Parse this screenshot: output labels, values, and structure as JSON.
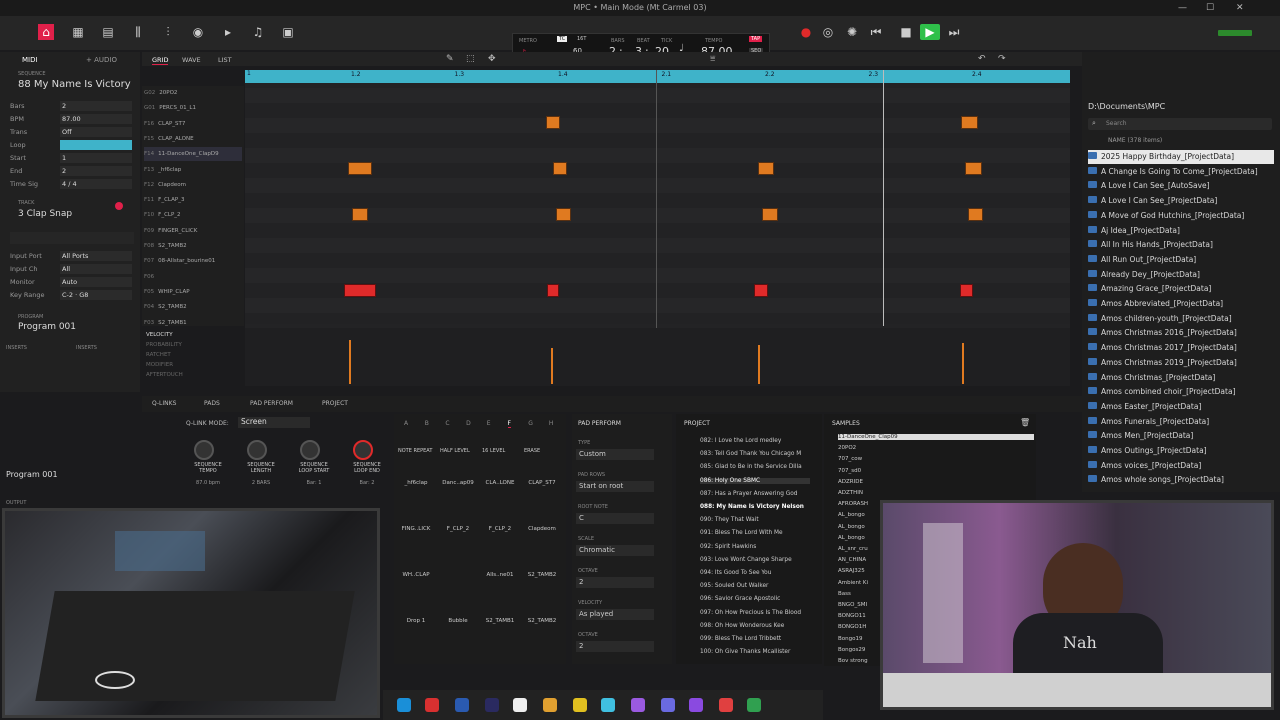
{
  "window_title": "MPC • Main Mode (Mt Carmel 03)",
  "toolbar": {
    "tempo": "87.00",
    "bar": "2",
    "beat": "3",
    "tick": "20",
    "bars_label": "BARS",
    "beat_label": "BEAT",
    "tick_label": "TICK",
    "tempo_label": "TEMPO",
    "tap_label": "TAP",
    "seq_label": "SEQ",
    "metro_label": "METRO",
    "tc_label": "TC",
    "sixteenth": "16T",
    "count": "60",
    "bpm_small": "BPM",
    "tc": "TC",
    "accent": "#e0204a"
  },
  "left": {
    "tab_midi": "MIDI",
    "tab_audio": "+ AUDIO",
    "sequence_label": "SEQUENCE",
    "sequence_name": "88 My Name Is Victory",
    "rows": [
      {
        "k": "Bars",
        "v": "2"
      },
      {
        "k": "BPM",
        "v": "87.00"
      },
      {
        "k": "Trans",
        "v": "Off"
      },
      {
        "k": "Loop",
        "v": ""
      },
      {
        "k": "Start",
        "v": "1"
      },
      {
        "k": "End",
        "v": "2"
      },
      {
        "k": "Time Sig",
        "v": "4   /   4"
      }
    ],
    "track_label": "TRACK",
    "track_name": "3 Clap Snap",
    "track_rows": [
      {
        "k": "Input Port",
        "v": "All Ports"
      },
      {
        "k": "Input Ch",
        "v": "All"
      },
      {
        "k": "Monitor",
        "v": "Auto"
      },
      {
        "k": "Key Range",
        "v": "C-2 · G8"
      }
    ],
    "program_label": "PROGRAM",
    "program_name": "Program 001",
    "inserts_1": "INSERTS",
    "inserts_2": "INSERTS",
    "program_bottom": "Program 001",
    "output": "OUTPUT"
  },
  "grid_tabs": {
    "grid": "GRID",
    "wave": "WAVE",
    "list": "LIST"
  },
  "ruler": [
    "1.2",
    "1.3",
    "1.4",
    "2.1",
    "2.2",
    "2.3",
    "2.4"
  ],
  "ruler_start": "1",
  "tracks": [
    {
      "p": "G02",
      "n": "20PO2"
    },
    {
      "p": "G01",
      "n": "PERCS_01_L1"
    },
    {
      "p": "F16",
      "n": "CLAP_ST7"
    },
    {
      "p": "F15",
      "n": "CLAP_ALONE"
    },
    {
      "p": "F14",
      "n": "11-DanceOne_ClapD9"
    },
    {
      "p": "F13",
      "n": "_hf6clap"
    },
    {
      "p": "F12",
      "n": "Clapdeom"
    },
    {
      "p": "F11",
      "n": "F_CLAP_3"
    },
    {
      "p": "F10",
      "n": "F_CLP_2"
    },
    {
      "p": "F09",
      "n": "FINGER_CLICK"
    },
    {
      "p": "F08",
      "n": "S2_TAMB2"
    },
    {
      "p": "F07",
      "n": "08-Allstar_bourine01"
    },
    {
      "p": "F06",
      "n": ""
    },
    {
      "p": "F05",
      "n": "WHIP_CLAP"
    },
    {
      "p": "F04",
      "n": "S2_TAMB2"
    },
    {
      "p": "F03",
      "n": "S2_TAMB1"
    }
  ],
  "lanes": [
    "VELOCITY",
    "PROBABILITY",
    "RATCHET",
    "MODIFIER",
    "AFTERTOUCH"
  ],
  "bottom_tabs": {
    "qlinks": "Q-LINKS",
    "pads": "PADS",
    "pad_perform": "PAD PERFORM",
    "project": "PROJECT"
  },
  "qlink": {
    "mode_label": "Q-LINK MODE:",
    "mode": "Screen",
    "knobs": [
      {
        "l": "SEQUENCE TEMPO",
        "v": "87.0 bpm"
      },
      {
        "l": "SEQUENCE LENGTH",
        "v": "2 BARS"
      },
      {
        "l": "SEQUENCE LOOP START",
        "v": "Bar: 1"
      },
      {
        "l": "SEQUENCE LOOP END",
        "v": "Bar: 2"
      }
    ]
  },
  "pad_banks": [
    "A",
    "B",
    "C",
    "D",
    "E",
    "F",
    "G",
    "H"
  ],
  "pad_modes": [
    "NOTE REPEAT",
    "HALF LEVEL",
    "16 LEVEL",
    "ERASE"
  ],
  "pads": [
    "_hf6clap",
    "Danc..ap09",
    "CLA..LONE",
    "CLAP_ST7",
    "FING..LICK",
    "F_CLP_2",
    "F_CLP_2",
    "Clapdeom",
    "WH..CLAP",
    "",
    "Alls..ne01",
    "S2_TAMB2",
    "Drop 1",
    "Bubble",
    "S2_TAMB1",
    "S2_TAMB2"
  ],
  "perform": {
    "title": "PAD PERFORM",
    "type_l": "TYPE",
    "type": "Custom",
    "rows_l": "PAD ROWS",
    "rows": "Start on root",
    "root_l": "ROOT NOTE",
    "root": "C",
    "scale_l": "SCALE",
    "scale": "Chromatic",
    "oct_l": "OCTAVE",
    "oct": "2",
    "vel_l": "VELOCITY",
    "vel": "As played",
    "oct2_l": "OCTAVE",
    "oct2": "2"
  },
  "project": {
    "title": "PROJECT",
    "items": [
      "082: I Love the Lord medley",
      "083: Tell God Thank You Chicago M",
      "085: Glad to Be in the Service Dilla",
      "086: Holy One SBMC",
      "087: Has a Prayer Answering God",
      "088: My Name Is Victory Nelson",
      "090: They That Wait",
      "091: Bless The Lord With Me",
      "092: Spirit Hawkins",
      "093: Love Wont Change Sharpe",
      "094: Its Good To See You",
      "095: Souled Out Walker",
      "096: Savior Grace Apostolic",
      "097: Oh How Precious Is The Blood",
      "098: Oh How Wonderous Kee",
      "099: Bless The Lord Tribbett",
      "100: Oh Give Thanks Mcallister"
    ]
  },
  "samples": {
    "title": "SAMPLES",
    "items": [
      "11-DanceOne_Clap09",
      "20PO2",
      "707_cow",
      "707_sd0",
      "ADZRIDE",
      "ADZTHIN",
      "AFRORASH",
      "AL_bongo",
      "AL_bongo",
      "AL_bongo",
      "AL_snr_cru",
      "AN_CHINA",
      "ASRAJ325",
      "Ambient Ki",
      "Bass",
      "BNGO_SMI",
      "BONGO11",
      "BONGO1H",
      "Bongo19",
      "Bongos29",
      "Bov strong"
    ]
  },
  "browser": {
    "path": "D:\\Documents\\MPC",
    "search": "Search",
    "header": "NAME (378 items)",
    "items": [
      "2025 Happy Birthday_[ProjectData]",
      "A Change Is Going To Come_[ProjectData]",
      "A Love I Can See_[AutoSave]",
      "A Love I Can See_[ProjectData]",
      "A Move of God Hutchins_[ProjectData]",
      "Aj Idea_[ProjectData]",
      "All In His Hands_[ProjectData]",
      "All Run Out_[ProjectData]",
      "Already Dey_[ProjectData]",
      "Amazing Grace_[ProjectData]",
      "Amos Abbreviated_[ProjectData]",
      "Amos children-youth_[ProjectData]",
      "Amos Christmas 2016_[ProjectData]",
      "Amos Christmas 2017_[ProjectData]",
      "Amos Christmas 2019_[ProjectData]",
      "Amos Christmas_[ProjectData]",
      "Amos combined choir_[ProjectData]",
      "Amos Easter_[ProjectData]",
      "Amos Funerals_[ProjectData]",
      "Amos Men_[ProjectData]",
      "Amos Outings_[ProjectData]",
      "Amos voices_[ProjectData]",
      "Amos whole songs_[ProjectData]"
    ]
  },
  "shirt_text": "Nah"
}
